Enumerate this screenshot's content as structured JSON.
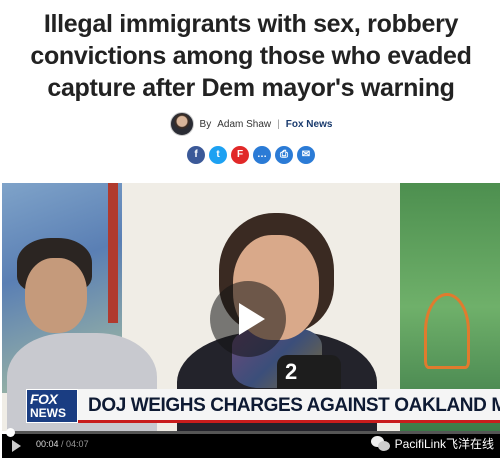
{
  "article": {
    "headline_line1": "Illegal immigrants with sex, robbery",
    "headline_line2": "convictions among those who evaded",
    "headline_line3": "capture after Dem mayor's warning",
    "byline_prefix": "By",
    "author": "Adam Shaw",
    "separator": "|",
    "source": "Fox News"
  },
  "share_buttons": [
    {
      "name": "facebook",
      "glyph": "f",
      "color": "#3b5998"
    },
    {
      "name": "twitter",
      "glyph": "t",
      "color": "#1da1f2"
    },
    {
      "name": "flipboard",
      "glyph": "F",
      "color": "#e12828"
    },
    {
      "name": "comments",
      "glyph": "…",
      "color": "#2b7bd6"
    },
    {
      "name": "print",
      "glyph": "⎙",
      "color": "#2b7bd6"
    },
    {
      "name": "email",
      "glyph": "✉",
      "color": "#2b7bd6"
    }
  ],
  "video": {
    "network_logo_top": "FOX",
    "network_logo_bottom": "NEWS",
    "chyron": "DOJ WEIGHS CHARGES AGAINST OAKLAND MAYOR",
    "mic_flag": "2",
    "current_time": "00:04",
    "time_separator": " / ",
    "duration": "04:07",
    "progress": 0.016
  },
  "watermark": {
    "text": "PacifiLink飞洋在线"
  }
}
